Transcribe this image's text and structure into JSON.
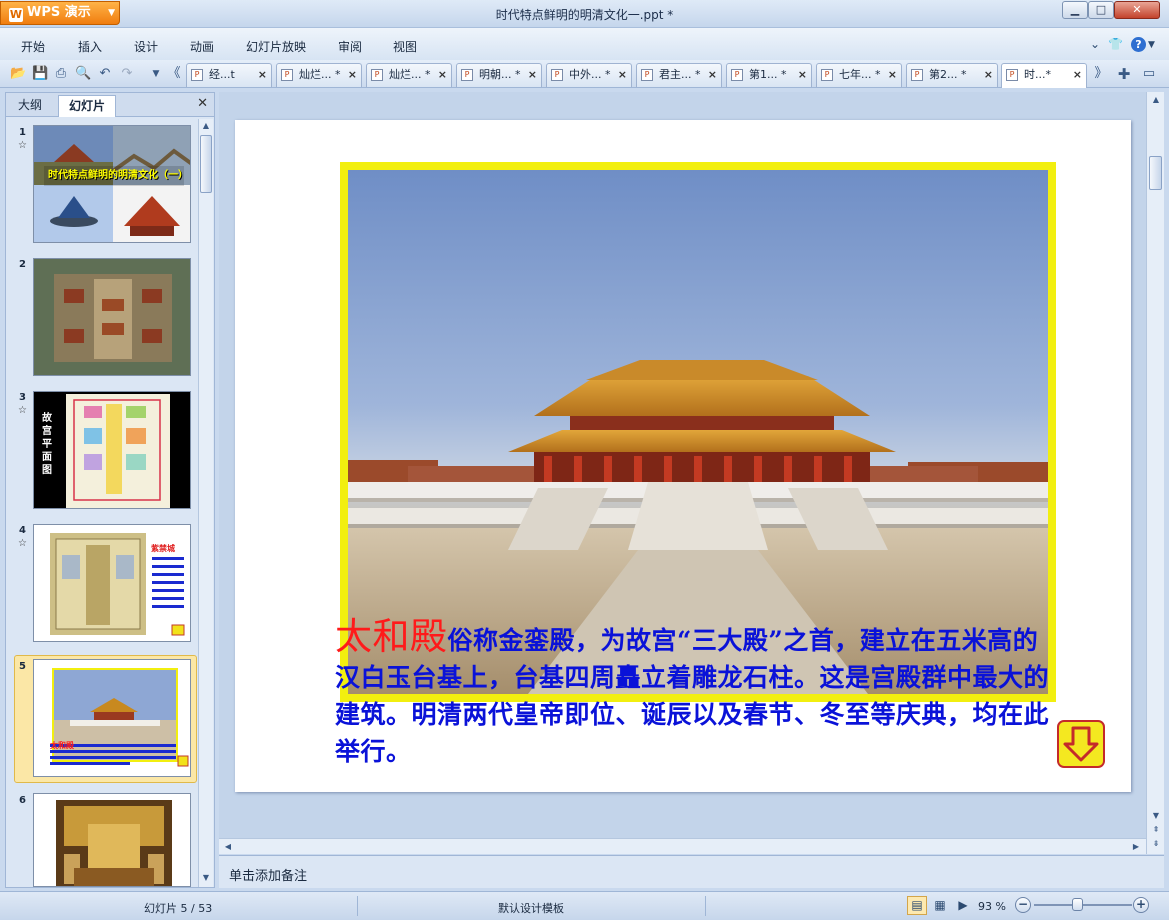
{
  "app": {
    "brand": "WPS 演示",
    "window_title": "时代特点鲜明的明清文化一.ppt *"
  },
  "menu": {
    "items": [
      "开始",
      "插入",
      "设计",
      "动画",
      "幻灯片放映",
      "审阅",
      "视图"
    ]
  },
  "tabs": [
    {
      "label": "经...t"
    },
    {
      "label": "灿烂... *"
    },
    {
      "label": "灿烂... *"
    },
    {
      "label": "明朝... *"
    },
    {
      "label": "中外... *"
    },
    {
      "label": "君主... *"
    },
    {
      "label": "第1... *"
    },
    {
      "label": "七年... *"
    },
    {
      "label": "第2... *"
    },
    {
      "label": "时...*",
      "active": true
    }
  ],
  "left_panel": {
    "tabs": [
      "大纲",
      "幻灯片"
    ],
    "active_tab": "幻灯片",
    "slides": [
      {
        "num": "1",
        "star": "☆",
        "caption": "时代特点鲜明的明清文化（一）"
      },
      {
        "num": "2",
        "star": ""
      },
      {
        "num": "3",
        "star": "☆",
        "caption": "故宫平面图"
      },
      {
        "num": "4",
        "star": "☆",
        "caption": "紫禁城"
      },
      {
        "num": "5",
        "star": "",
        "caption": "太和殿",
        "selected": true
      },
      {
        "num": "6",
        "star": ""
      }
    ]
  },
  "slide": {
    "highlight": "太和殿",
    "body": "俗称金銮殿，为故宫“三大殿”之首，建立在五米高的汉白玉台基上，台基四周矗立着雕龙石柱。这是宫殿群中最大的建筑。明清两代皇帝即位、诞辰以及春节、冬至等庆典，均在此举行。"
  },
  "notes": {
    "placeholder": "单击添加备注"
  },
  "status": {
    "slide_counter": "幻灯片 5 / 53",
    "template": "默认设计模板",
    "zoom": "93 %",
    "zoom_level_percent": 93
  },
  "colors": {
    "accent_orange": "#f07d0f",
    "slide_text_blue": "#0a12d8",
    "slide_highlight_red": "#ff1a1a",
    "frame_yellow": "#f2ef0f"
  }
}
